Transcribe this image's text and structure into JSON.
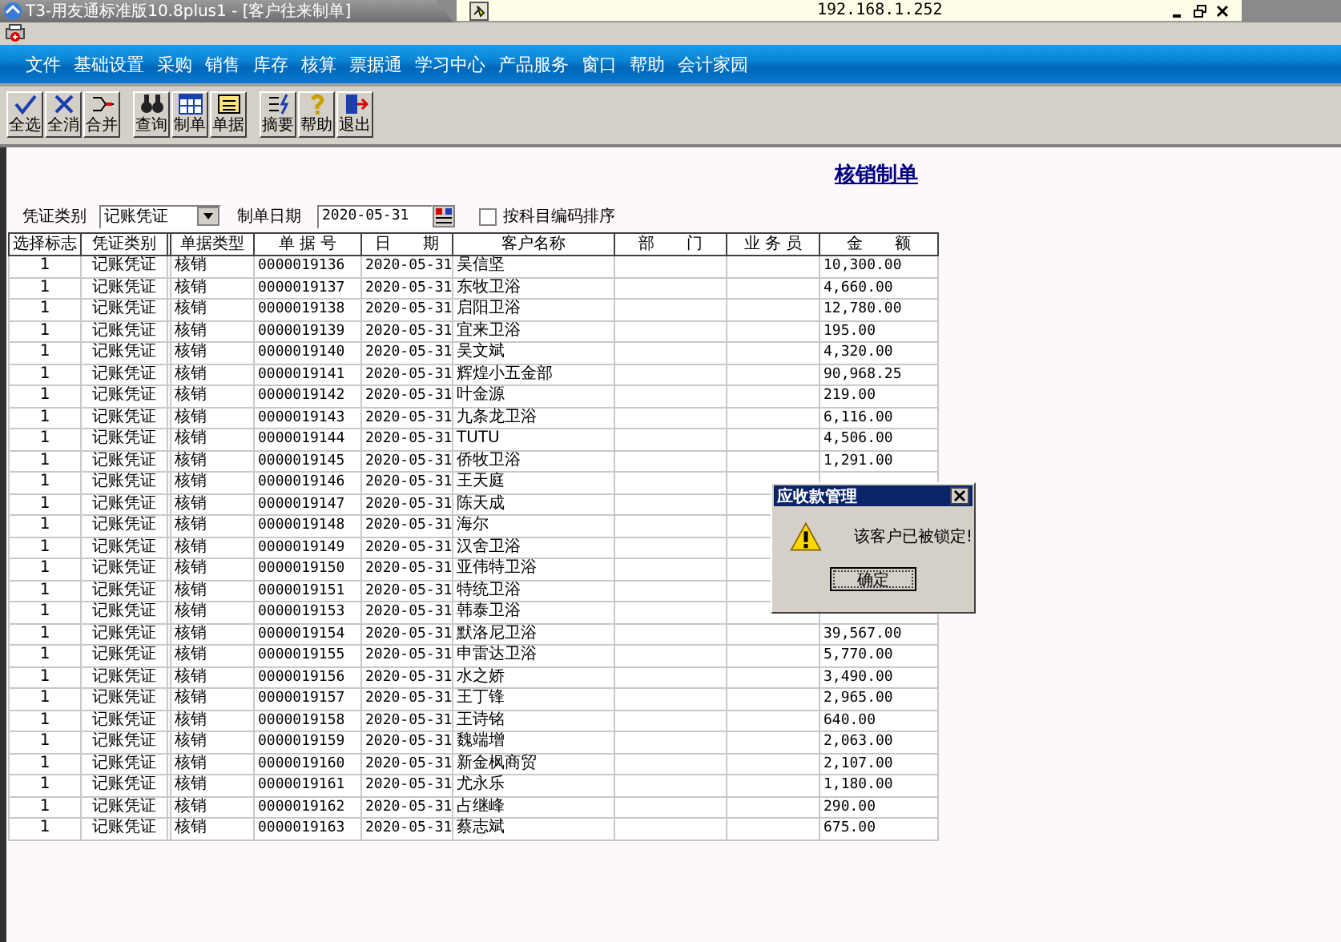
{
  "window": {
    "title": "T3-用友通标准版10.8plus1 - [客户往来制单]",
    "host": "192.168.1.252"
  },
  "menu": [
    "文件",
    "基础设置",
    "采购",
    "销售",
    "库存",
    "核算",
    "票据通",
    "学习中心",
    "产品服务",
    "窗口",
    "帮助",
    "会计家园"
  ],
  "toolbar": [
    [
      {
        "label": "全选",
        "kind": "check"
      },
      {
        "label": "全消",
        "kind": "cross"
      },
      {
        "label": "合并",
        "kind": "merge"
      }
    ],
    [
      {
        "label": "查询",
        "kind": "binoculars"
      },
      {
        "label": "制单",
        "kind": "grid"
      },
      {
        "label": "单据",
        "kind": "folder"
      }
    ],
    [
      {
        "label": "摘要",
        "kind": "summary"
      },
      {
        "label": "帮助",
        "kind": "help"
      },
      {
        "label": "退出",
        "kind": "exit"
      }
    ]
  ],
  "page_title": "核销制单",
  "form": {
    "voucher_label": "凭证类别",
    "voucher_value": "记账凭证",
    "date_label": "制单日期",
    "date_value": "2020-05-31",
    "sort_checked": false,
    "sort_label": "按科目编码排序"
  },
  "table": {
    "columns": [
      "选择标志",
      "凭证类别",
      "单据类型",
      "单 据 号",
      "日　　期",
      "客户名称",
      "部　　门",
      "业 务 员",
      "金　　额"
    ],
    "rows": [
      {
        "flag": "1",
        "voucher": "记账凭证",
        "type": "核销",
        "no": "0000019136",
        "date": "2020-05-31",
        "customer": "吴信坚",
        "amount": "10,300.00"
      },
      {
        "flag": "1",
        "voucher": "记账凭证",
        "type": "核销",
        "no": "0000019137",
        "date": "2020-05-31",
        "customer": "东牧卫浴",
        "amount": "4,660.00"
      },
      {
        "flag": "1",
        "voucher": "记账凭证",
        "type": "核销",
        "no": "0000019138",
        "date": "2020-05-31",
        "customer": "启阳卫浴",
        "amount": "12,780.00"
      },
      {
        "flag": "1",
        "voucher": "记账凭证",
        "type": "核销",
        "no": "0000019139",
        "date": "2020-05-31",
        "customer": "宜来卫浴",
        "amount": "195.00"
      },
      {
        "flag": "1",
        "voucher": "记账凭证",
        "type": "核销",
        "no": "0000019140",
        "date": "2020-05-31",
        "customer": "吴文斌",
        "amount": "4,320.00"
      },
      {
        "flag": "1",
        "voucher": "记账凭证",
        "type": "核销",
        "no": "0000019141",
        "date": "2020-05-31",
        "customer": "辉煌小五金部",
        "amount": "90,968.25"
      },
      {
        "flag": "1",
        "voucher": "记账凭证",
        "type": "核销",
        "no": "0000019142",
        "date": "2020-05-31",
        "customer": "叶金源",
        "amount": "219.00"
      },
      {
        "flag": "1",
        "voucher": "记账凭证",
        "type": "核销",
        "no": "0000019143",
        "date": "2020-05-31",
        "customer": "九条龙卫浴",
        "amount": "6,116.00"
      },
      {
        "flag": "1",
        "voucher": "记账凭证",
        "type": "核销",
        "no": "0000019144",
        "date": "2020-05-31",
        "customer": "TUTU",
        "amount": "4,506.00"
      },
      {
        "flag": "1",
        "voucher": "记账凭证",
        "type": "核销",
        "no": "0000019145",
        "date": "2020-05-31",
        "customer": "侨牧卫浴",
        "amount": "1,291.00"
      },
      {
        "flag": "1",
        "voucher": "记账凭证",
        "type": "核销",
        "no": "0000019146",
        "date": "2020-05-31",
        "customer": "王天庭"
      },
      {
        "flag": "1",
        "voucher": "记账凭证",
        "type": "核销",
        "no": "0000019147",
        "date": "2020-05-31",
        "customer": "陈天成"
      },
      {
        "flag": "1",
        "voucher": "记账凭证",
        "type": "核销",
        "no": "0000019148",
        "date": "2020-05-31",
        "customer": "海尔"
      },
      {
        "flag": "1",
        "voucher": "记账凭证",
        "type": "核销",
        "no": "0000019149",
        "date": "2020-05-31",
        "customer": "汉舍卫浴"
      },
      {
        "flag": "1",
        "voucher": "记账凭证",
        "type": "核销",
        "no": "0000019150",
        "date": "2020-05-31",
        "customer": "亚伟特卫浴"
      },
      {
        "flag": "1",
        "voucher": "记账凭证",
        "type": "核销",
        "no": "0000019151",
        "date": "2020-05-31",
        "customer": "特统卫浴"
      },
      {
        "flag": "1",
        "voucher": "记账凭证",
        "type": "核销",
        "no": "0000019153",
        "date": "2020-05-31",
        "customer": "韩泰卫浴"
      },
      {
        "flag": "1",
        "voucher": "记账凭证",
        "type": "核销",
        "no": "0000019154",
        "date": "2020-05-31",
        "customer": "默洛尼卫浴",
        "amount": "39,567.00"
      },
      {
        "flag": "1",
        "voucher": "记账凭证",
        "type": "核销",
        "no": "0000019155",
        "date": "2020-05-31",
        "customer": "申雷达卫浴",
        "amount": "5,770.00"
      },
      {
        "flag": "1",
        "voucher": "记账凭证",
        "type": "核销",
        "no": "0000019156",
        "date": "2020-05-31",
        "customer": "水之娇",
        "amount": "3,490.00"
      },
      {
        "flag": "1",
        "voucher": "记账凭证",
        "type": "核销",
        "no": "0000019157",
        "date": "2020-05-31",
        "customer": "王丁锋",
        "amount": "2,965.00"
      },
      {
        "flag": "1",
        "voucher": "记账凭证",
        "type": "核销",
        "no": "0000019158",
        "date": "2020-05-31",
        "customer": "王诗铭",
        "amount": "640.00"
      },
      {
        "flag": "1",
        "voucher": "记账凭证",
        "type": "核销",
        "no": "0000019159",
        "date": "2020-05-31",
        "customer": "魏端增",
        "amount": "2,063.00"
      },
      {
        "flag": "1",
        "voucher": "记账凭证",
        "type": "核销",
        "no": "0000019160",
        "date": "2020-05-31",
        "customer": "新金枫商贸",
        "amount": "2,107.00"
      },
      {
        "flag": "1",
        "voucher": "记账凭证",
        "type": "核销",
        "no": "0000019161",
        "date": "2020-05-31",
        "customer": "尤永乐",
        "amount": "1,180.00"
      },
      {
        "flag": "1",
        "voucher": "记账凭证",
        "type": "核销",
        "no": "0000019162",
        "date": "2020-05-31",
        "customer": "占继峰",
        "amount": "290.00"
      },
      {
        "flag": "1",
        "voucher": "记账凭证",
        "type": "核销",
        "no": "0000019163",
        "date": "2020-05-31",
        "customer": "蔡志斌",
        "amount": "675.00"
      }
    ]
  },
  "dialog": {
    "title": "应收款管理",
    "message": "该客户已被锁定!",
    "button": "确定"
  }
}
